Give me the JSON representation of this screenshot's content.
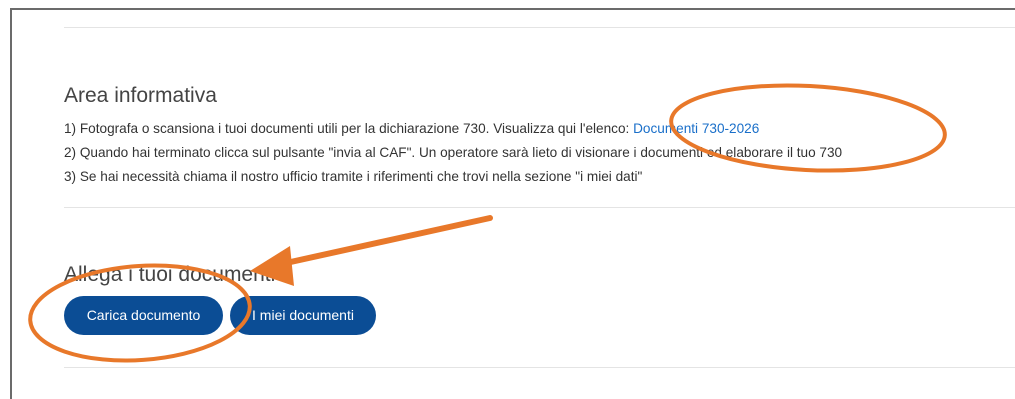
{
  "info_section": {
    "title": "Area informativa",
    "line1_text": "1) Fotografa o scansiona i tuoi documenti utili per la dichiarazione 730. Visualizza qui l'elenco: ",
    "line1_link": "Documenti 730-2026",
    "line2_text": "2) Quando hai terminato clicca sul pulsante \"invia al CAF\". Un operatore sarà lieto di visionare i documenti ed elaborare il tuo 730",
    "line3_text": "3) Se hai necessità chiama il nostro ufficio tramite i riferimenti che trovi nella sezione \"i miei dati\""
  },
  "attach_section": {
    "title": "Allega i tuoi documenti",
    "upload_button": "Carica documento",
    "my_docs_button": "I miei documenti"
  },
  "colors": {
    "button_bg": "#0b4d95",
    "link": "#1a6fc9",
    "annotation": "#e8782a"
  }
}
